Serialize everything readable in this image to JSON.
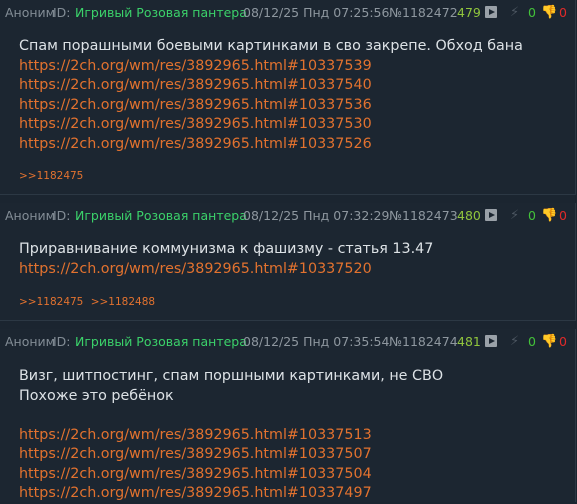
{
  "posts": [
    {
      "anon": "Аноним",
      "id_label": "ID:",
      "poster_id": "Игривый Розовая пантера",
      "date": "08/12/25 Пнд 07:25:56",
      "number": "№1182472",
      "replies": "479",
      "likes": "0",
      "dislikes": "0",
      "text": [
        "Спам порашными боевыми картинками в сво закрепе. Обход бана"
      ],
      "links": [
        "https://2ch.org/wm/res/3892965.html#10337539",
        "https://2ch.org/wm/res/3892965.html#10337540",
        "https://2ch.org/wm/res/3892965.html#10337536",
        "https://2ch.org/wm/res/3892965.html#10337530",
        "https://2ch.org/wm/res/3892965.html#10337526"
      ],
      "refs": [
        ">>1182475"
      ]
    },
    {
      "anon": "Аноним",
      "id_label": "ID:",
      "poster_id": "Игривый Розовая пантера",
      "date": "08/12/25 Пнд 07:32:29",
      "number": "№1182473",
      "replies": "480",
      "likes": "0",
      "dislikes": "0",
      "text": [
        "Приравнивание коммунизма к фашизму - статья 13.47"
      ],
      "links": [
        "https://2ch.org/wm/res/3892965.html#10337520"
      ],
      "refs": [
        ">>1182475",
        ">>1182488"
      ]
    },
    {
      "anon": "Аноним",
      "id_label": "ID:",
      "poster_id": "Игривый Розовая пантера",
      "date": "08/12/25 Пнд 07:35:54",
      "number": "№1182474",
      "replies": "481",
      "likes": "0",
      "dislikes": "0",
      "text": [
        "Визг, шитпостинг, спам поршными картинками, не СВО",
        "Похоже это ребёнок"
      ],
      "links": [
        "https://2ch.org/wm/res/3892965.html#10337513",
        "https://2ch.org/wm/res/3892965.html#10337507",
        "https://2ch.org/wm/res/3892965.html#10337504",
        "https://2ch.org/wm/res/3892965.html#10337497"
      ],
      "refs": []
    }
  ],
  "icons": {
    "play": "play-icon",
    "bolt": "⚡",
    "thumb_up": "👍",
    "thumb_down": "👎"
  },
  "colors": {
    "background": "#1c2631",
    "poster_id": "#3bd16a",
    "link": "#e2722f",
    "replies_count": "#90c53d",
    "like": "#43c23a",
    "dislike": "#e02a2a"
  }
}
